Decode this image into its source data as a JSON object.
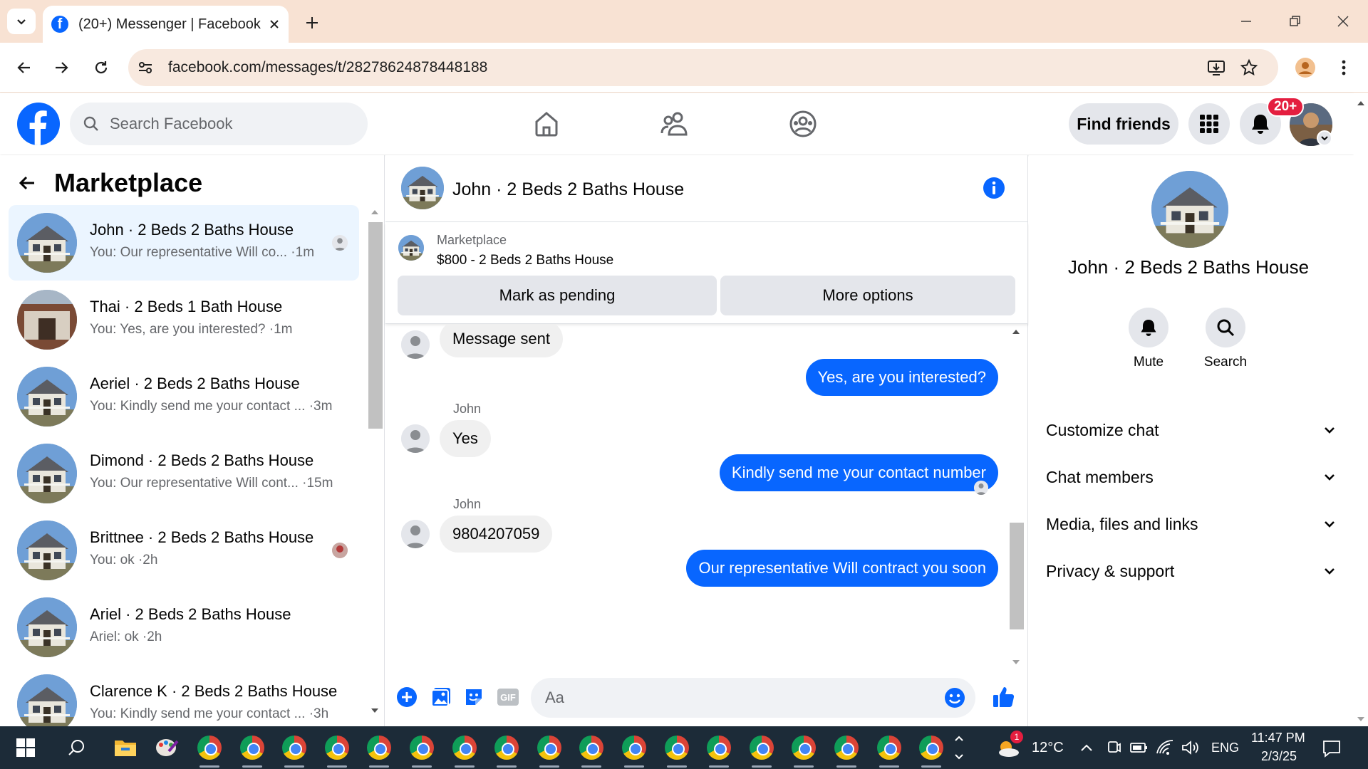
{
  "browser": {
    "tab_title": "(20+) Messenger | Facebook",
    "url": "facebook.com/messages/t/28278624878448188"
  },
  "header": {
    "search_placeholder": "Search Facebook",
    "find_friends_label": "Find friends",
    "notification_badge": "20+"
  },
  "sidebar": {
    "title": "Marketplace",
    "conversations": [
      {
        "name": "John · 2 Beds 2 Baths House",
        "preview": "You: Our representative Will co... ·1m",
        "selected": true
      },
      {
        "name": "Thai · 2 Beds 1 Bath House",
        "preview": "You: Yes, are you interested? ·1m",
        "selected": false
      },
      {
        "name": "Aeriel · 2 Beds 2 Baths House",
        "preview": "You: Kindly send me your contact ... ·3m",
        "selected": false
      },
      {
        "name": "Dimond · 2 Beds 2 Baths House",
        "preview": "You: Our representative Will cont... ·15m",
        "selected": false
      },
      {
        "name": "Brittnee · 2 Beds 2 Baths House",
        "preview": "You: ok ·2h",
        "selected": false
      },
      {
        "name": "Ariel · 2 Beds 2 Baths House",
        "preview": "Ariel: ok ·2h",
        "selected": false
      },
      {
        "name": "Clarence K · 2 Beds 2 Baths House",
        "preview": "You: Kindly send me your contact ... ·3h",
        "selected": false
      }
    ]
  },
  "chat": {
    "title": "John · 2 Beds 2 Baths House",
    "marketplace_label": "Marketplace",
    "listing": "$800 - 2 Beds 2 Baths House",
    "mark_pending_label": "Mark as pending",
    "more_options_label": "More options",
    "messages": [
      {
        "from": "them",
        "sender": "",
        "text": "Message sent"
      },
      {
        "from": "me",
        "text": "Yes, are you interested?"
      },
      {
        "from": "them",
        "sender": "John",
        "text": "Yes"
      },
      {
        "from": "me",
        "text": "Kindly send me your contact number"
      },
      {
        "from": "them",
        "sender": "John",
        "text": "9804207059"
      },
      {
        "from": "me",
        "text": "Our representative Will contract you soon"
      }
    ],
    "input_placeholder": "Aa"
  },
  "details": {
    "name": "John · 2 Beds 2 Baths House",
    "mute_label": "Mute",
    "search_label": "Search",
    "sections": [
      "Customize chat",
      "Chat members",
      "Media, files and links",
      "Privacy & support"
    ]
  },
  "taskbar": {
    "temperature": "12°C",
    "language": "ENG",
    "time": "11:47 PM",
    "date": "2/3/25",
    "weather_badge": "1"
  },
  "colors": {
    "accent": "#0866ff",
    "selected_row": "#ebf5ff",
    "badge": "#e41e3f",
    "tabbar": "#f8e2d3"
  }
}
